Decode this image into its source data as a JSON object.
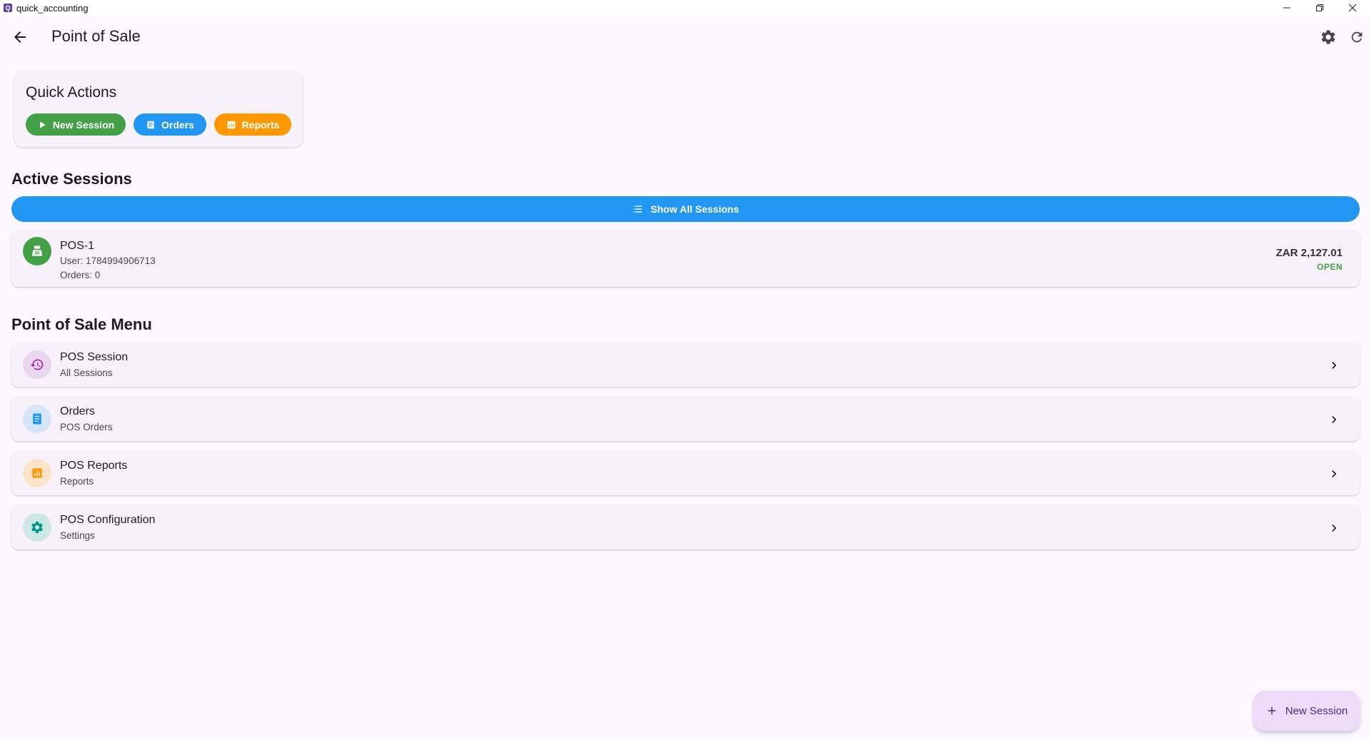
{
  "window": {
    "title": "quick_accounting"
  },
  "appbar": {
    "title": "Point of Sale"
  },
  "quick_actions": {
    "title": "Quick Actions",
    "buttons": [
      {
        "label": "New Session",
        "color": "#43a047",
        "icon": "play-icon"
      },
      {
        "label": "Orders",
        "color": "#2196f3",
        "icon": "receipt-icon"
      },
      {
        "label": "Reports",
        "color": "#ff9800",
        "icon": "bar-chart-icon"
      }
    ]
  },
  "active_sessions": {
    "title": "Active Sessions",
    "show_all_label": "Show All Sessions",
    "sessions": [
      {
        "name": "POS-1",
        "user": "User: 1784994906713",
        "orders": "Orders: 0",
        "amount": "ZAR 2,127.01",
        "status": "OPEN",
        "icon": "cash-register-icon"
      }
    ]
  },
  "menu": {
    "title": "Point of Sale Menu",
    "items": [
      {
        "title": "POS Session",
        "subtitle": "All Sessions",
        "icon": "history-icon",
        "color": "#9c27b0"
      },
      {
        "title": "Orders",
        "subtitle": "POS Orders",
        "icon": "receipt-icon",
        "color": "#2196f3"
      },
      {
        "title": "POS Reports",
        "subtitle": "Reports",
        "icon": "bar-chart-icon",
        "color": "#ff9800"
      },
      {
        "title": "POS Configuration",
        "subtitle": "Settings",
        "icon": "gear-icon",
        "color": "#009688"
      }
    ]
  },
  "fab": {
    "label": "New Session"
  }
}
